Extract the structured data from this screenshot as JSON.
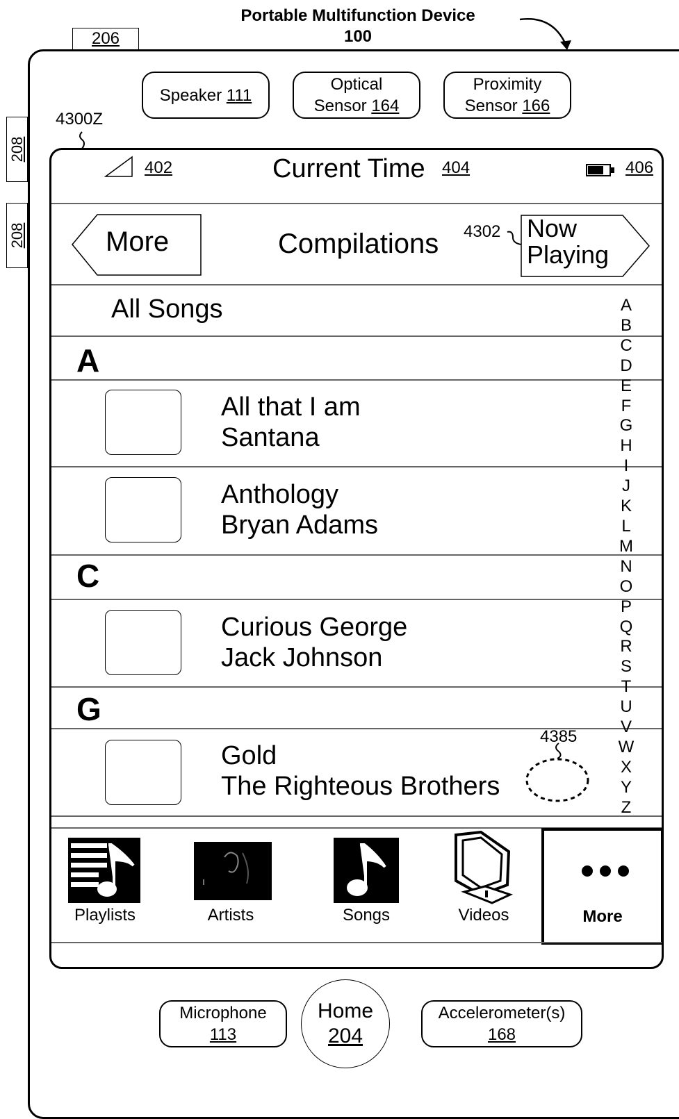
{
  "header": {
    "title": "Portable Multifunction Device",
    "ref": "100",
    "ref_206": "206"
  },
  "side_refs": [
    "208",
    "208"
  ],
  "sensors": [
    {
      "label": "Speaker",
      "ref": "111"
    },
    {
      "label_line1": "Optical",
      "label_line2": "Sensor",
      "ref": "164"
    },
    {
      "label_line1": "Proximity",
      "label_line2": "Sensor",
      "ref": "166"
    }
  ],
  "screen_ref": "4300Z",
  "status_bar": {
    "signal_ref": "402",
    "time": "Current Time",
    "time_ref": "404",
    "battery_ref": "406"
  },
  "nav": {
    "back": "More",
    "title": "Compilations",
    "now_playing_line1": "Now",
    "now_playing_line2": "Playing",
    "now_playing_ref": "4302"
  },
  "all_songs": "All Songs",
  "sections": [
    {
      "letter": "A",
      "rows": [
        {
          "title": "All that I am",
          "artist": "Santana"
        },
        {
          "title": "Anthology",
          "artist": "Bryan Adams"
        }
      ]
    },
    {
      "letter": "C",
      "rows": [
        {
          "title": "Curious George",
          "artist": "Jack Johnson"
        }
      ]
    },
    {
      "letter": "G",
      "rows": [
        {
          "title": "Gold",
          "artist": "The Righteous Brothers"
        }
      ]
    }
  ],
  "gesture_ref": "4385",
  "index_letters": [
    "A",
    "B",
    "C",
    "D",
    "E",
    "F",
    "G",
    "H",
    "I",
    "J",
    "K",
    "L",
    "M",
    "N",
    "O",
    "P",
    "Q",
    "R",
    "S",
    "T",
    "U",
    "V",
    "W",
    "X",
    "Y",
    "Z"
  ],
  "tabs": [
    {
      "label": "Playlists",
      "icon": "playlist-icon"
    },
    {
      "label": "Artists",
      "icon": "artist-icon"
    },
    {
      "label": "Songs",
      "icon": "music-note-icon"
    },
    {
      "label": "Videos",
      "icon": "tv-icon"
    },
    {
      "label": "More",
      "icon": "ellipsis-icon",
      "selected": true
    }
  ],
  "hardware": {
    "microphone": {
      "label": "Microphone",
      "ref": "113"
    },
    "home": {
      "label": "Home",
      "ref": "204"
    },
    "accelerometer": {
      "label": "Accelerometer(s)",
      "ref": "168"
    }
  }
}
